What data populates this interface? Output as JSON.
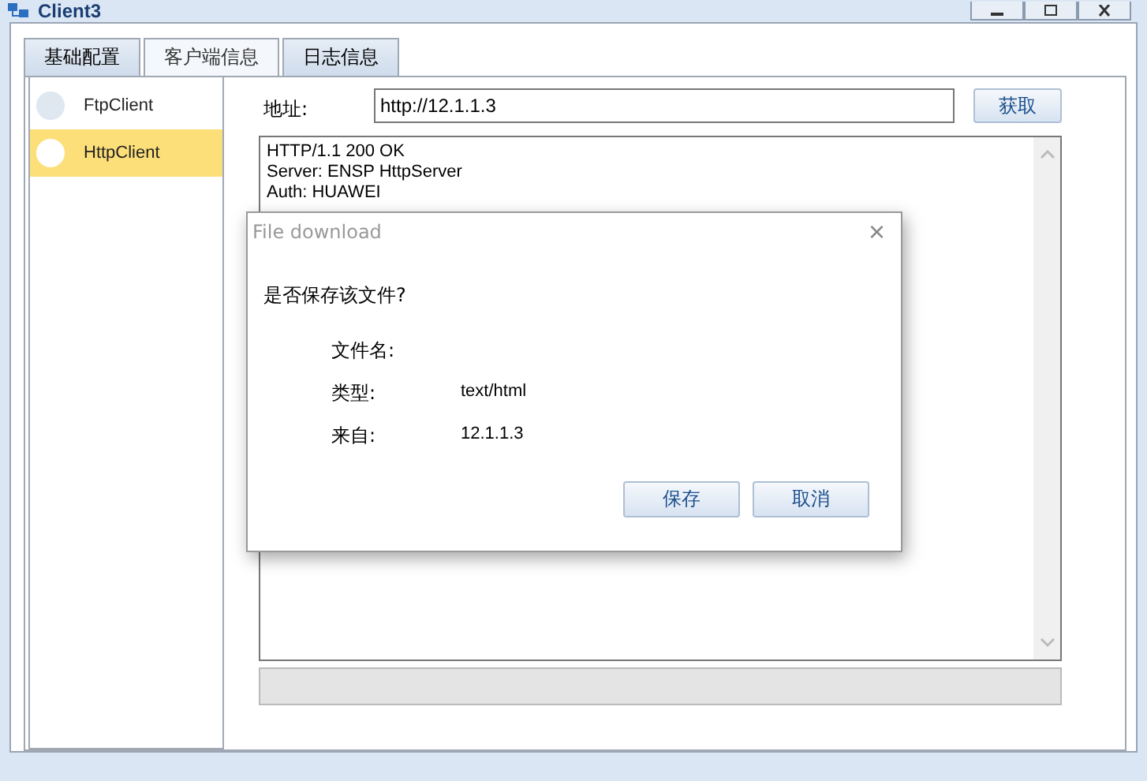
{
  "window": {
    "title": "Client3"
  },
  "tabs": [
    {
      "label": "基础配置",
      "selected": false
    },
    {
      "label": "客户端信息",
      "selected": true
    },
    {
      "label": "日志信息",
      "selected": false
    }
  ],
  "sidebar": {
    "items": [
      {
        "label": "FtpClient",
        "selected": false
      },
      {
        "label": "HttpClient",
        "selected": true
      }
    ]
  },
  "address": {
    "label": "地址:",
    "value": "http://12.1.1.3"
  },
  "fetch_button": "获取",
  "response_lines": [
    "HTTP/1.1 200 OK",
    "Server: ENSP HttpServer",
    "Auth: HUAWEI"
  ],
  "dialog": {
    "title": "File download",
    "close": "×",
    "question": "是否保存该文件?",
    "fields": [
      {
        "label": "文件名:"
      },
      {
        "label": "类型:",
        "value": "text/html"
      },
      {
        "label": "来自:",
        "value": "12.1.1.3"
      }
    ],
    "buttons": [
      "保存",
      "取消"
    ]
  }
}
